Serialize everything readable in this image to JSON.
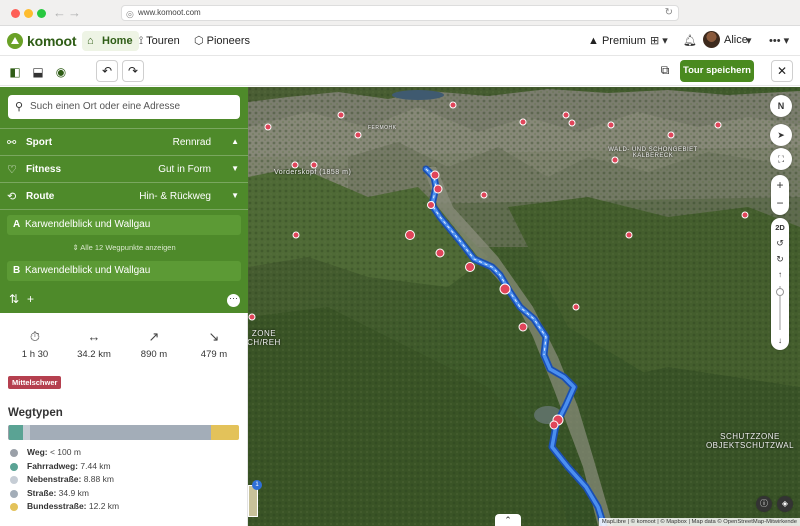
{
  "browser": {
    "url": "www.komoot.com"
  },
  "header": {
    "brand": "komoot",
    "nav": [
      {
        "label": "Home"
      },
      {
        "label": "Touren"
      },
      {
        "label": "Pioneers"
      }
    ],
    "premium": "Premium",
    "user": "Alice"
  },
  "toolbar": {
    "save_label": "Tour speichern"
  },
  "planner": {
    "search_placeholder": "Such einen Ort oder eine Adresse",
    "sport": {
      "label": "Sport",
      "value": "Rennrad"
    },
    "fitness": {
      "label": "Fitness",
      "value": "Gut in Form"
    },
    "route": {
      "label": "Route",
      "value": "Hin- & Rückweg"
    },
    "waypoint_a": {
      "tag": "A",
      "name": "Karwendelblick und Wallgau"
    },
    "waypoint_b": {
      "tag": "B",
      "name": "Karwendelblick und Wallgau"
    },
    "all_waypoints": "Alle 12 Wegpunkte anzeigen"
  },
  "stats": {
    "duration": "1 h 30",
    "distance": "34.2 km",
    "ascent": "890 m",
    "descent": "479 m",
    "difficulty": "Mittelschwer"
  },
  "wegtypen": {
    "title": "Wegtypen",
    "items": [
      {
        "name": "Weg:",
        "value": "< 100 m",
        "color": "#9aa0a8",
        "share": 0.005
      },
      {
        "name": "Fahrradweg:",
        "value": "7.44 km",
        "color": "#5aa394",
        "share": 0.062
      },
      {
        "name": "Nebenstraße:",
        "value": "8.88 km",
        "color": "#c6cdd5",
        "share": 0.03
      },
      {
        "name": "Straße:",
        "value": "34.9 km",
        "color": "#a3adb8",
        "share": 0.78
      },
      {
        "name": "Bundesstraße:",
        "value": "12.2 km",
        "color": "#e3c25a",
        "share": 0.123
      }
    ]
  },
  "map": {
    "labels": [
      "Vorderskopf (1858 m)",
      "WALD- UND SCHONGEBIET KALBERECK",
      "SCHUTZZONE OBJEKTSCHUTZWAL",
      "ZONE CH/REH",
      "FERMOHK"
    ],
    "attribution": "MapLibre | © komoot | © Mapbox | Map data © OpenStreetMap-Mitwirkende",
    "controls": {
      "mode": "2D",
      "north": "N"
    },
    "layer_badge": "1"
  }
}
